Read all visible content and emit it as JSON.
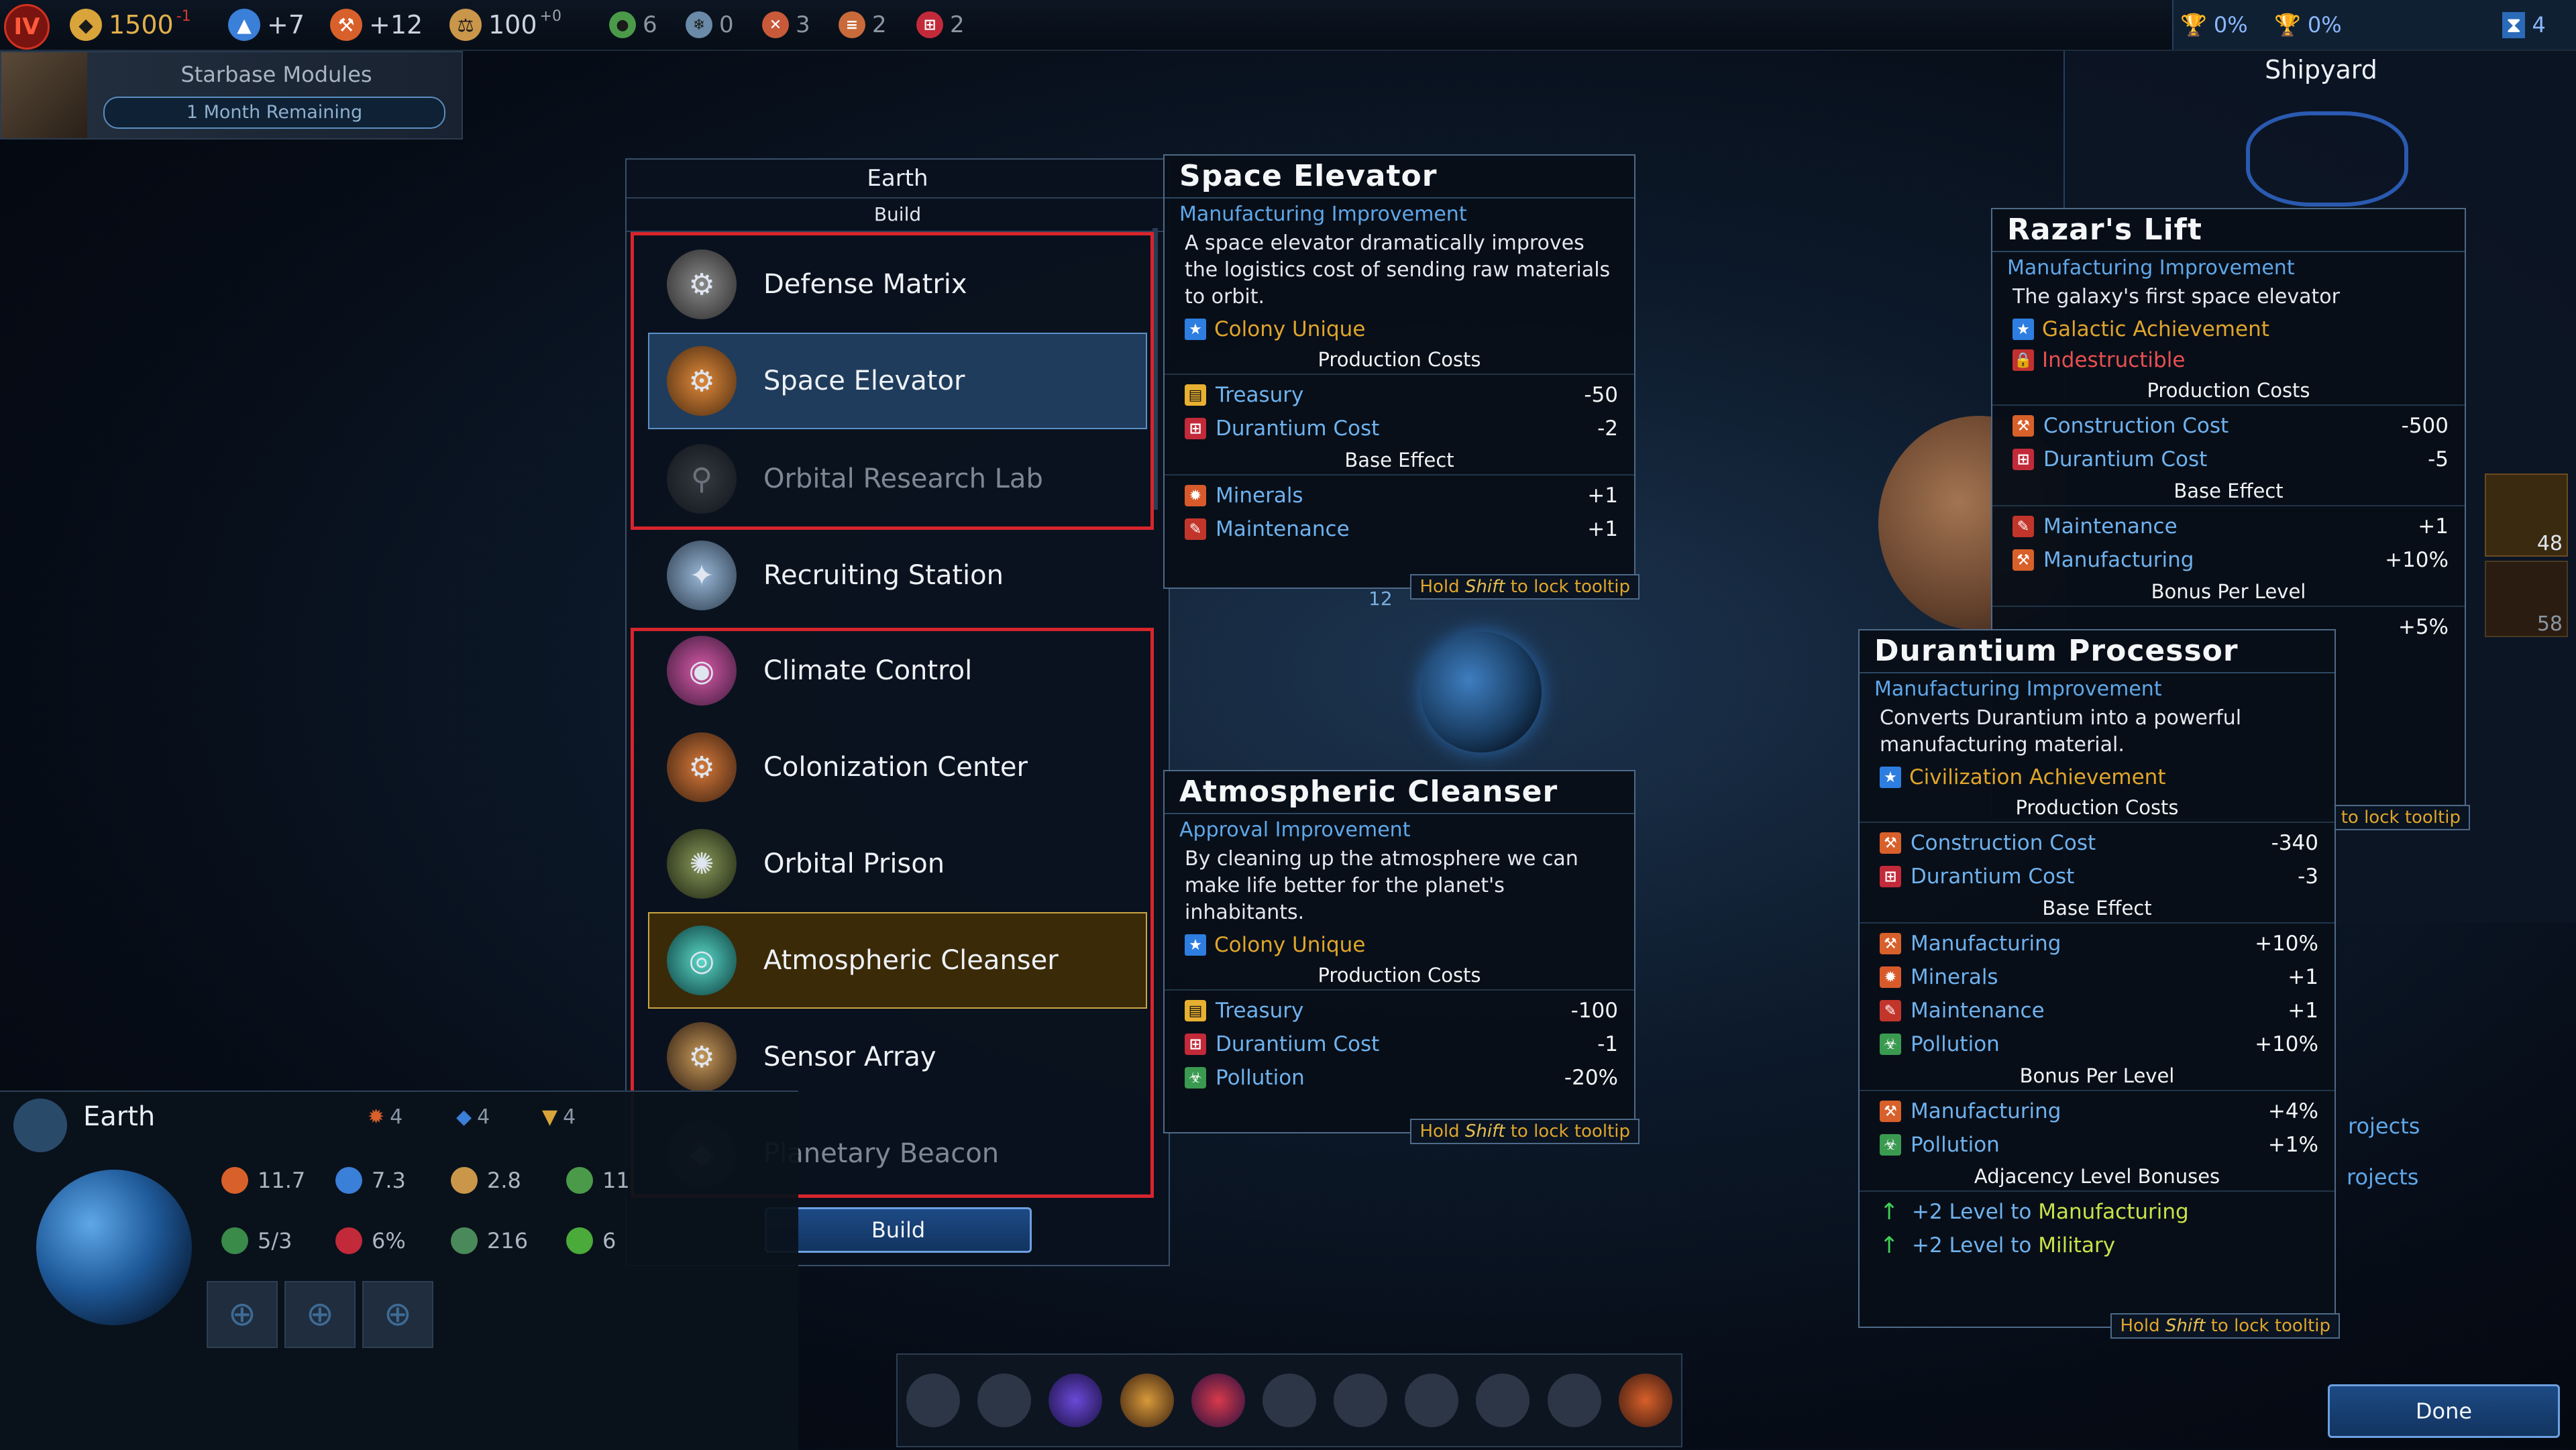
{
  "topbar": {
    "civ_logo": "IV",
    "credits": "1500",
    "credits_delta": "-1",
    "research": "+7",
    "production": "+12",
    "influence": "100",
    "influence_delta": "+0",
    "food_count": "6",
    "ice_count": "0",
    "military_count": "3",
    "stack_count": "2",
    "durantium_count": "2",
    "victory_pct_1": "0%",
    "victory_pct_2": "0%",
    "turns_icon_value": "4"
  },
  "starbase": {
    "title": "Starbase Modules",
    "status": "1 Month Remaining"
  },
  "build_panel": {
    "planet": "Earth",
    "tab": "Build",
    "items": [
      {
        "label": "Defense Matrix",
        "icon": "defense-matrix-icon"
      },
      {
        "label": "Space Elevator",
        "icon": "space-elevator-icon"
      },
      {
        "label": "Orbital Research Lab",
        "icon": "orbital-research-lab-icon"
      },
      {
        "label": "Recruiting Station",
        "icon": "recruiting-station-icon"
      },
      {
        "label": "Climate Control",
        "icon": "climate-control-icon"
      },
      {
        "label": "Colonization Center",
        "icon": "colonization-center-icon"
      },
      {
        "label": "Orbital Prison",
        "icon": "orbital-prison-icon"
      },
      {
        "label": "Atmospheric Cleanser",
        "icon": "atmospheric-cleanser-icon"
      },
      {
        "label": "Sensor Array",
        "icon": "sensor-array-icon"
      },
      {
        "label": "Planetary Beacon",
        "icon": "planetary-beacon-icon"
      }
    ],
    "build_button": "Build"
  },
  "tooltip_space_elevator": {
    "title": "Space Elevator",
    "category": "Manufacturing Improvement",
    "description": "A space elevator dramatically improves the logistics cost of sending raw materials to orbit.",
    "tag": "Colony Unique",
    "production_costs_header": "Production Costs",
    "costs": [
      {
        "name": "Treasury",
        "value": "-50"
      },
      {
        "name": "Durantium Cost",
        "value": "-2"
      }
    ],
    "base_effect_header": "Base Effect",
    "effects": [
      {
        "name": "Minerals",
        "value": "+1"
      },
      {
        "name": "Maintenance",
        "value": "+1"
      }
    ],
    "hold_pre": "Hold ",
    "hold_key": "Shift",
    "hold_post": " to lock tooltip"
  },
  "tooltip_atmo": {
    "title": "Atmospheric Cleanser",
    "category": "Approval Improvement",
    "description": "By cleaning up the atmosphere we can make life better for the planet's inhabitants.",
    "tag": "Colony Unique",
    "production_costs_header": "Production Costs",
    "costs": [
      {
        "name": "Treasury",
        "value": "-100"
      },
      {
        "name": "Durantium Cost",
        "value": "-1"
      },
      {
        "name": "Pollution",
        "value": "-20%"
      }
    ],
    "hold_pre": "Hold ",
    "hold_key": "Shift",
    "hold_post": " to lock tooltip"
  },
  "tooltip_razar": {
    "title": "Razar's Lift",
    "category": "Manufacturing Improvement",
    "description": "The galaxy's first space elevator",
    "tag1": "Galactic Achievement",
    "tag2": "Indestructible",
    "production_costs_header": "Production Costs",
    "costs": [
      {
        "name": "Construction Cost",
        "value": "-500"
      },
      {
        "name": "Durantium Cost",
        "value": "-5"
      }
    ],
    "base_effect_header": "Base Effect",
    "effects": [
      {
        "name": "Maintenance",
        "value": "+1"
      },
      {
        "name": "Manufacturing",
        "value": "+10%"
      }
    ],
    "bonus_header": "Bonus Per Level",
    "bonus_value": "+5%",
    "hold_post": "to lock tooltip"
  },
  "tooltip_durantium": {
    "title": "Durantium Processor",
    "category": "Manufacturing Improvement",
    "description": "Converts Durantium into a powerful manufacturing material.",
    "tag": "Civilization Achievement",
    "production_costs_header": "Production Costs",
    "costs": [
      {
        "name": "Construction Cost",
        "value": "-340"
      },
      {
        "name": "Durantium Cost",
        "value": "-3"
      }
    ],
    "base_effect_header": "Base Effect",
    "effects": [
      {
        "name": "Manufacturing",
        "value": "+10%"
      },
      {
        "name": "Minerals",
        "value": "+1"
      },
      {
        "name": "Maintenance",
        "value": "+1"
      },
      {
        "name": "Pollution",
        "value": "+10%"
      }
    ],
    "bonus_header": "Bonus Per Level",
    "bonuses": [
      {
        "name": "Manufacturing",
        "value": "+4%"
      },
      {
        "name": "Pollution",
        "value": "+1%"
      }
    ],
    "adjacency_header": "Adjacency Level Bonuses",
    "adjacency": [
      {
        "prefix": "+2 Level to ",
        "name": "Manufacturing"
      },
      {
        "prefix": "+2 Level to ",
        "name": "Military"
      }
    ],
    "hold_pre": "Hold ",
    "hold_key": "Shift",
    "hold_post": " to lock tooltip"
  },
  "shipyard": {
    "title": "Shipyard",
    "item_count_1": "48",
    "item_count_2": "58",
    "projects_label": "rojects"
  },
  "map": {
    "fleet_count": "12"
  },
  "planet_panel": {
    "name": "Earth",
    "badge1": "4",
    "badge2": "4",
    "badge3": "4",
    "stats": [
      {
        "icon": "production-icon",
        "value": "11.7"
      },
      {
        "icon": "science-icon",
        "value": "7.3"
      },
      {
        "icon": "influence-icon",
        "value": "2.8"
      },
      {
        "icon": "food-icon",
        "value": "11"
      },
      {
        "icon": "population-icon",
        "value": "5/3"
      },
      {
        "icon": "pollution-icon",
        "value": "6%"
      },
      {
        "icon": "defense-icon",
        "value": "216"
      },
      {
        "icon": "approval-icon",
        "value": "6"
      }
    ]
  },
  "done_button": "Done",
  "colors": {
    "accent_blue": "#5fa7e8",
    "gold": "#e0a52b",
    "highlight_red": "#d7252d"
  }
}
